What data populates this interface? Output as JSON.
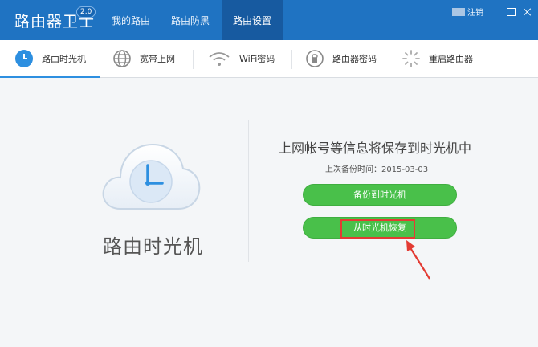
{
  "app": {
    "title": "路由器卫士",
    "version": "2.0"
  },
  "nav": {
    "tabs": [
      {
        "label": "我的路由",
        "active": false
      },
      {
        "label": "路由防黑",
        "active": false
      },
      {
        "label": "路由设置",
        "active": true
      }
    ]
  },
  "window": {
    "logout_label": "注销"
  },
  "subnav": {
    "items": [
      {
        "label": "路由时光机",
        "icon": "cloud-clock-icon",
        "active": true
      },
      {
        "label": "宽带上网",
        "icon": "globe-icon",
        "active": false
      },
      {
        "label": "WiFi密码",
        "icon": "wifi-icon",
        "active": false
      },
      {
        "label": "路由器密码",
        "icon": "lock-circle-icon",
        "active": false
      },
      {
        "label": "重启路由器",
        "icon": "restart-spinner-icon",
        "active": false
      }
    ]
  },
  "content": {
    "feature_title": "路由时光机",
    "info_title": "上网帐号等信息将保存到时光机中",
    "last_backup": "上次备份时间：2015-03-03",
    "backup_button": "备份到时光机",
    "restore_button": "从时光机恢复"
  },
  "colors": {
    "header_bg": "#1f73c2",
    "active_tab_bg": "#175aa0",
    "button_green": "#49c04a",
    "highlight_red": "#e33b33",
    "accent_blue": "#2d8fe0"
  }
}
